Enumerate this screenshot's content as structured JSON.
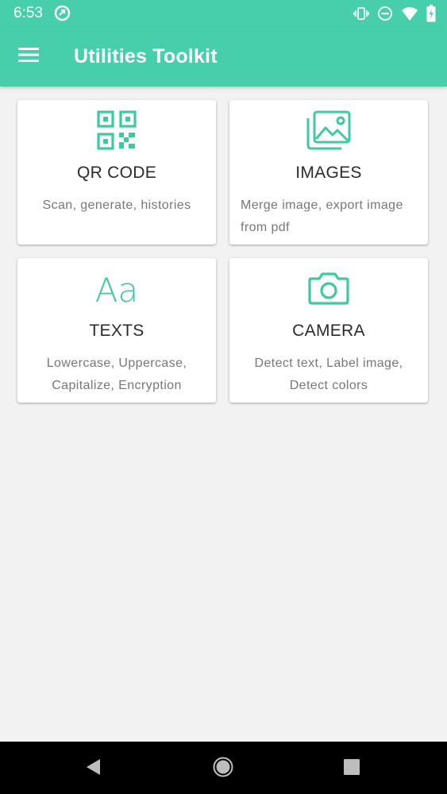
{
  "status": {
    "time": "6:53",
    "icons": [
      "app-notification-icon",
      "vibrate-icon",
      "do-not-disturb-icon",
      "wifi-icon",
      "battery-icon"
    ]
  },
  "appbar": {
    "title": "Utilities Toolkit",
    "menu_icon": "hamburger-menu-icon"
  },
  "cards": [
    {
      "title": "QR CODE",
      "desc": "Scan, generate, histories",
      "icon": "qr-code-icon"
    },
    {
      "title": "IMAGES",
      "desc": "Merge image, export image from pdf",
      "icon": "image-gallery-icon"
    },
    {
      "title": "TEXTS",
      "desc": "Lowercase, Uppercase, Capitalize, Encryption",
      "icon": "text-format-icon"
    },
    {
      "title": "CAMERA",
      "desc": "Detect text, Label image, Detect colors",
      "icon": "camera-icon"
    }
  ],
  "navbar": {
    "back_icon": "back-triangle-icon",
    "home_icon": "home-circle-icon",
    "recents_icon": "recents-square-icon"
  },
  "colors": {
    "primary": "#46cfaa",
    "accent_icon": "#3cc9a3",
    "background": "#f2f2f2",
    "card": "#ffffff",
    "title_text": "#2b2b2b",
    "desc_text": "#777777"
  },
  "icon_glyphs": {
    "text_format": "Aa"
  }
}
